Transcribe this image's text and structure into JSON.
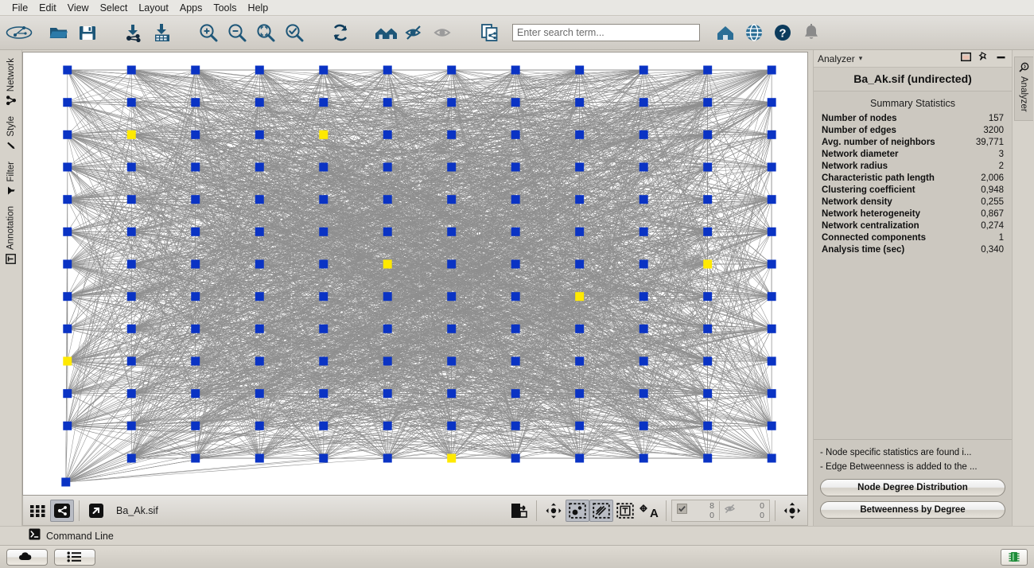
{
  "menubar": {
    "items": [
      {
        "label": "File"
      },
      {
        "label": "Edit"
      },
      {
        "label": "View"
      },
      {
        "label": "Select"
      },
      {
        "label": "Layout"
      },
      {
        "label": "Apps"
      },
      {
        "label": "Tools"
      },
      {
        "label": "Help"
      }
    ]
  },
  "toolbar": {
    "icons": [
      {
        "name": "cytoscape-logo-icon",
        "title": "Cytoscape"
      },
      {
        "name": "open-folder-icon",
        "title": "Open"
      },
      {
        "name": "save-icon",
        "title": "Save"
      },
      {
        "name": "import-network-icon",
        "title": "Import Network From File"
      },
      {
        "name": "import-table-icon",
        "title": "Import Table From File"
      },
      {
        "name": "zoom-in-icon",
        "title": "Zoom In"
      },
      {
        "name": "zoom-out-icon",
        "title": "Zoom Out"
      },
      {
        "name": "zoom-fit-icon",
        "title": "Zoom Out to Display All"
      },
      {
        "name": "zoom-selected-icon",
        "title": "Zoom Selected Region"
      },
      {
        "name": "refresh-icon",
        "title": "Apply Layout"
      },
      {
        "name": "hide-neighbors-icon",
        "title": "Select Neighbors"
      },
      {
        "name": "hide-unselected-icon",
        "title": "Hide Unselected"
      },
      {
        "name": "show-all-icon",
        "title": "Show All"
      },
      {
        "name": "clone-network-icon",
        "title": "New Network From Selection"
      }
    ],
    "right_icons": [
      {
        "name": "home-icon",
        "title": "Home"
      },
      {
        "name": "globe-icon",
        "title": "Web"
      },
      {
        "name": "help-icon",
        "title": "Help"
      },
      {
        "name": "bell-icon",
        "title": "Notifications"
      }
    ]
  },
  "search": {
    "placeholder": "Enter search term...",
    "value": ""
  },
  "left_tabs": [
    {
      "label": "Network",
      "icon": "network-icon"
    },
    {
      "label": "Style",
      "icon": "brush-icon"
    },
    {
      "label": "Filter",
      "icon": "funnel-icon"
    },
    {
      "label": "Annotation",
      "icon": "text-box-icon"
    }
  ],
  "view_toolbar": {
    "network_title": "Ba_Ak.sif",
    "buttons": [
      {
        "name": "grid-view-button",
        "label": "Grid View",
        "active": false
      },
      {
        "name": "network-view-button",
        "label": "Network View",
        "active": true
      },
      {
        "name": "detach-view-button",
        "label": "Detach View",
        "active": false
      },
      {
        "name": "export-image-button",
        "label": "Export Image",
        "active": false
      },
      {
        "name": "fit-selected-button",
        "label": "Fit Selected",
        "active": false
      },
      {
        "name": "select-nodes-button",
        "label": "Select Nodes",
        "active": true
      },
      {
        "name": "select-edges-button",
        "label": "Select Edges",
        "active": true
      },
      {
        "name": "select-annotations-button",
        "label": "Select Annotations",
        "active": false
      },
      {
        "name": "show-labels-button",
        "label": "Show Labels",
        "active": false
      },
      {
        "name": "rotate-button",
        "label": "Rotate / Fit",
        "active": false
      }
    ],
    "counters": {
      "selected_nodes": "8",
      "total_nodes": "0",
      "selected_edges": "0",
      "total_edges": "0"
    }
  },
  "analyzer_panel": {
    "tab_label": "Analyzer",
    "dropdown_caret": "▾",
    "header_buttons": [
      {
        "name": "float-panel-button",
        "label": "Float"
      },
      {
        "name": "pin-panel-button",
        "label": "Pin"
      },
      {
        "name": "minimize-panel-button",
        "label": "Minimize"
      }
    ],
    "network_title": "Ba_Ak.sif (undirected)",
    "section_title": "Summary Statistics",
    "stats": [
      {
        "key": "Number of nodes",
        "value": "157"
      },
      {
        "key": "Number of edges",
        "value": "3200"
      },
      {
        "key": "Avg. number of neighbors",
        "value": "39,771"
      },
      {
        "key": "Network diameter",
        "value": "3"
      },
      {
        "key": "Network radius",
        "value": "2"
      },
      {
        "key": "Characteristic path length",
        "value": "2,006"
      },
      {
        "key": "Clustering coefficient",
        "value": "0,948"
      },
      {
        "key": "Network density",
        "value": "0,255"
      },
      {
        "key": "Network heterogeneity",
        "value": "0,867"
      },
      {
        "key": "Network centralization",
        "value": "0,274"
      },
      {
        "key": "Connected components",
        "value": "1"
      },
      {
        "key": "Analysis time (sec)",
        "value": "0,340"
      }
    ],
    "notes": [
      "- Node specific statistics are found i...",
      "- Edge Betweenness is added to the ..."
    ],
    "buttons": [
      {
        "name": "node-degree-distribution-button",
        "label": "Node Degree Distribution"
      },
      {
        "name": "betweenness-by-degree-button",
        "label": "Betweenness by Degree"
      }
    ],
    "side_tab_label": "Analyzer"
  },
  "command_line": {
    "label": "Command Line",
    "icon": "terminal-icon"
  },
  "statusbar": {
    "buttons": [
      {
        "name": "cloud-status-button",
        "label": "Cloud"
      },
      {
        "name": "task-list-button",
        "label": "Tasks"
      }
    ],
    "memory_indicator": {
      "name": "memory-chip-icon",
      "label": "Free Memory"
    }
  },
  "colors": {
    "node_default": "#0a33c4",
    "node_selected": "#ffe900",
    "edge": "#8a8a8a",
    "canvas_bg": "#ffffff",
    "chrome_bg": "#d6d2ca",
    "panel_bg": "#ccc8c0",
    "toolbar_icon": "#1d5678",
    "accent_blue": "#1b5e86"
  },
  "network_view": {
    "grid_columns": 12,
    "grid_rows": 13,
    "selected_node_positions": [
      {
        "col": 1,
        "row": 2
      },
      {
        "col": 4,
        "row": 2
      },
      {
        "col": 5,
        "row": 6
      },
      {
        "col": 10,
        "row": 6
      },
      {
        "col": 8,
        "row": 7
      },
      {
        "col": 0,
        "row": 9
      },
      {
        "col": 6,
        "row": 12
      },
      {
        "col": 0,
        "row": 13
      }
    ]
  }
}
